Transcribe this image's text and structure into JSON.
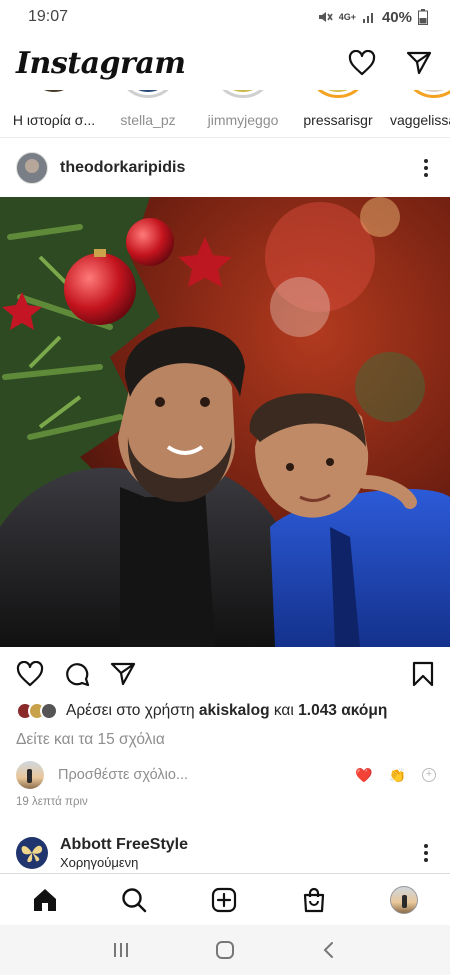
{
  "status": {
    "time": "19:07",
    "network": "4G+",
    "battery": "40%"
  },
  "app": {
    "title": "Instagram"
  },
  "stories": [
    {
      "label": "Η ιστορία σ...",
      "seen": false
    },
    {
      "label": "stella_pz",
      "seen": true
    },
    {
      "label": "jimmyjeggo",
      "seen": true
    },
    {
      "label": "pressarisgr",
      "seen": false
    },
    {
      "label": "vaggelissa",
      "seen": false
    }
  ],
  "post": {
    "username": "theodorkaripidis",
    "likes_prefix": "Αρέσει στο χρήστη",
    "likes_user": "akiskalog",
    "likes_mid": "και",
    "likes_count": "1.043 ακόμη",
    "view_comments": "Δείτε και τα 15 σχόλια",
    "comment_placeholder": "Προσθέστε σχόλιο...",
    "quick_reactions": [
      "❤️",
      "👏"
    ],
    "time_ago": "19 λεπτά πριν"
  },
  "sponsored": {
    "name": "Abbott FreeStyle",
    "label": "Χορηγούμενη"
  },
  "colors": {
    "accent": "#e1306c",
    "text": "#262626",
    "muted": "#8e8e8e",
    "heart": "#ed2d3a"
  }
}
